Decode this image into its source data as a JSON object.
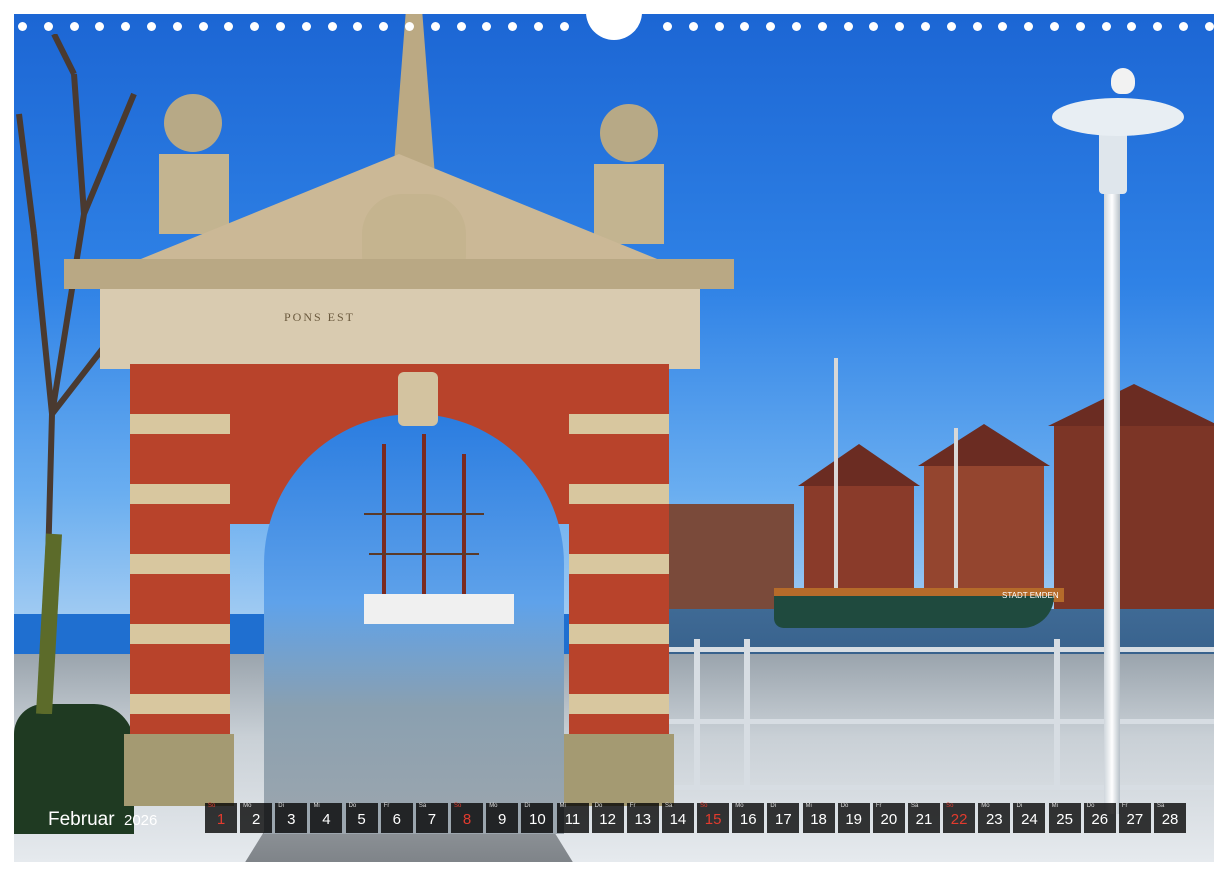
{
  "calendar": {
    "month": "Februar",
    "year": "2026",
    "days": [
      {
        "wd": "So",
        "d": "1",
        "sunday": true
      },
      {
        "wd": "Mo",
        "d": "2"
      },
      {
        "wd": "Di",
        "d": "3"
      },
      {
        "wd": "Mi",
        "d": "4"
      },
      {
        "wd": "Do",
        "d": "5"
      },
      {
        "wd": "Fr",
        "d": "6"
      },
      {
        "wd": "Sa",
        "d": "7"
      },
      {
        "wd": "So",
        "d": "8",
        "sunday": true
      },
      {
        "wd": "Mo",
        "d": "9"
      },
      {
        "wd": "Di",
        "d": "10"
      },
      {
        "wd": "Mi",
        "d": "11"
      },
      {
        "wd": "Do",
        "d": "12"
      },
      {
        "wd": "Fr",
        "d": "13"
      },
      {
        "wd": "Sa",
        "d": "14"
      },
      {
        "wd": "So",
        "d": "15",
        "sunday": true
      },
      {
        "wd": "Mo",
        "d": "16"
      },
      {
        "wd": "Di",
        "d": "17"
      },
      {
        "wd": "Mi",
        "d": "18"
      },
      {
        "wd": "Do",
        "d": "19"
      },
      {
        "wd": "Fr",
        "d": "20"
      },
      {
        "wd": "Sa",
        "d": "21"
      },
      {
        "wd": "So",
        "d": "22",
        "sunday": true
      },
      {
        "wd": "Mo",
        "d": "23"
      },
      {
        "wd": "Di",
        "d": "24"
      },
      {
        "wd": "Mi",
        "d": "25"
      },
      {
        "wd": "Do",
        "d": "26"
      },
      {
        "wd": "Fr",
        "d": "27"
      },
      {
        "wd": "Sa",
        "d": "28"
      }
    ]
  },
  "photo": {
    "inscription": "PONS EST",
    "ship_name": "STADT EMDEN"
  },
  "colors": {
    "sky": "#1f6fd0",
    "brick": "#b8432b",
    "sandstone": "#d8c79f",
    "sunday": "#e23b2e",
    "calendar_cell": "#000000"
  }
}
